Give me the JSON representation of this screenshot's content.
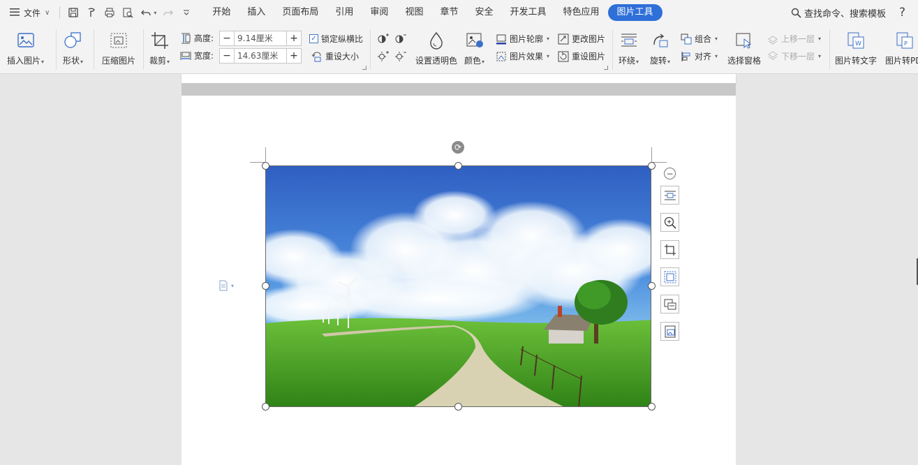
{
  "menubar": {
    "file_label": "文件",
    "tabs": [
      "开始",
      "插入",
      "页面布局",
      "引用",
      "审阅",
      "视图",
      "章节",
      "安全",
      "开发工具",
      "特色应用",
      "图片工具"
    ],
    "active_tab": "图片工具",
    "search_label": "查找命令、搜索模板",
    "help_label": "?"
  },
  "ribbon": {
    "insert_picture": "插入图片",
    "shape": "形状",
    "compress": "压缩图片",
    "crop": "裁剪",
    "height_label": "高度:",
    "height_value": "9.14厘米",
    "width_label": "宽度:",
    "width_value": "14.63厘米",
    "lock_ratio": "锁定纵横比",
    "reset_size": "重设大小",
    "set_transparent": "设置透明色",
    "color": "颜色",
    "picture_outline": "图片轮廓",
    "picture_effect": "图片效果",
    "change_picture": "更改图片",
    "reset_picture": "重设图片",
    "wrap": "环绕",
    "rotate": "旋转",
    "group": "组合",
    "align": "对齐",
    "selection_pane": "选择窗格",
    "bring_forward": "上移一层",
    "send_backward": "下移一层",
    "picture_to_text": "图片转文字",
    "picture_to_pdf": "图片转PDF"
  },
  "colors": {
    "accent": "#2e6fd8",
    "sky_top": "#2f5fc2",
    "grass": "#3e9a22"
  }
}
